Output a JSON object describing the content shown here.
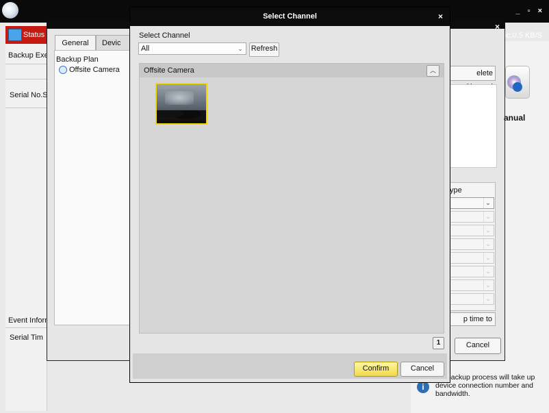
{
  "app": {
    "window_controls": "_ ▫ ×",
    "traffic": "affic:0.5 KB/S",
    "status_tab": "Status",
    "backup_exec": "Backup Exec",
    "serial_header": "Serial No.Sc",
    "event_info": "Event Inform",
    "event_columns": "Serial  Tim",
    "info_text": "nel backup process will take up device connection number and bandwidth.",
    "info_icon": "i"
  },
  "plan_dialog": {
    "close": "×",
    "tabs": [
      "General",
      "Devic"
    ],
    "backup_plan_title": "Backup Plan",
    "plan_item": "Offsite Camera",
    "delete_channel": "elete Channel",
    "manual_label": "anual",
    "type_header": "ype",
    "time_to": "p time to",
    "cancel": "Cancel"
  },
  "select_channel": {
    "title": "Select Channel",
    "close": "×",
    "label": "Select Channel",
    "filter_value": "All",
    "refresh": "Refresh",
    "group_title": "Offsite Camera",
    "thumbnail_timestamp": "· · · · · · · · · ·",
    "page_number": "1",
    "confirm": "Confirm",
    "cancel": "Cancel"
  },
  "colors": {
    "status_tab": "#c41a12",
    "confirm_button": "#f0d84a",
    "thumbnail_border": "#f2d600"
  }
}
